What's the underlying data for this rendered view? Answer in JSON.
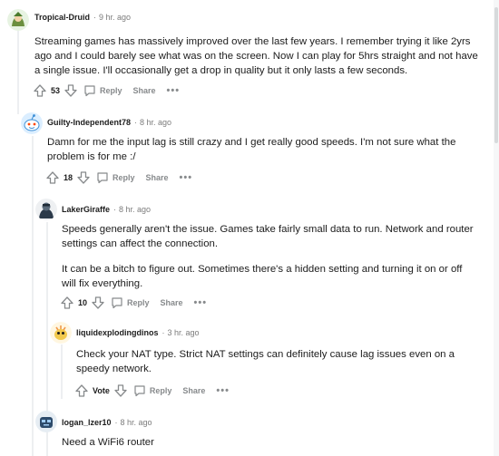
{
  "comments": [
    {
      "author": "Tropical-Druid",
      "time": "9 hr. ago",
      "paragraphs": [
        "Streaming games has massively improved over the last few years. I remember trying it like 2yrs",
        "ago and I could barely see what was on the screen. Now I can play for 5hrs straight and not have",
        "a single issue. I'll occasionally get a drop in quality but it only lasts a few seconds."
      ],
      "score": "53",
      "reply": "Reply",
      "share": "Share",
      "more": "•••"
    },
    {
      "author": "Guilty-Independent78",
      "time": "8 hr. ago",
      "paragraphs": [
        "Damn for me the input lag is still crazy and I get really good speeds. I'm not sure what the",
        "problem is for me :/"
      ],
      "score": "18",
      "reply": "Reply",
      "share": "Share",
      "more": "•••"
    },
    {
      "author": "LakerGiraffe",
      "time": "8 hr. ago",
      "paragraphs": [
        "Speeds generally aren't the issue. Games take fairly small data to run. Network and router",
        "settings can affect the connection.",
        "It can be a bitch to figure out. Sometimes there's a hidden setting and turning it on or off",
        "will fix everything."
      ],
      "score": "10",
      "reply": "Reply",
      "share": "Share",
      "more": "•••"
    },
    {
      "author": "liquidexplodingdinos",
      "time": "3 hr. ago",
      "paragraphs": [
        "Check your NAT type. Strict NAT settings can definitely cause lag issues even on a",
        "speedy network."
      ],
      "score": "Vote",
      "reply": "Reply",
      "share": "Share",
      "more": "•••"
    },
    {
      "author": "logan_lzer10",
      "time": "8 hr. ago",
      "paragraphs": [
        "Need a WiFi6 router"
      ]
    }
  ],
  "separator": "·",
  "icons": {
    "upvote": "upvote-icon",
    "downvote": "downvote-icon",
    "reply": "reply-bubble-icon"
  },
  "colors": {
    "meta": "#7c7c7c",
    "action": "#878a8c",
    "thread_line": "#edeff1"
  }
}
